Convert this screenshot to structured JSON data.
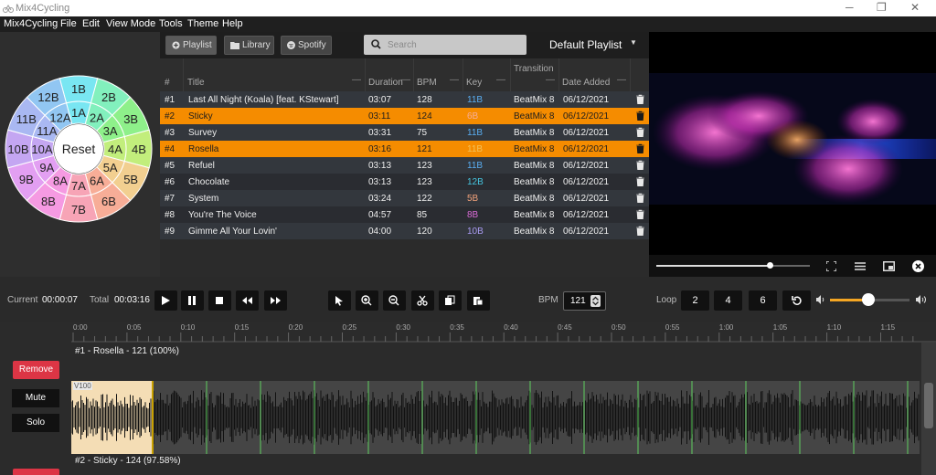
{
  "window": {
    "title": "Mix4Cycling",
    "controls": [
      "─",
      "❐",
      "✕"
    ]
  },
  "menu": [
    "Mix4Cycling",
    "File",
    "Edit",
    "View Mode",
    "Tools",
    "Theme",
    "Help"
  ],
  "wheel": {
    "outer": [
      "1B",
      "2B",
      "3B",
      "4B",
      "5B",
      "6B",
      "7B",
      "8B",
      "9B",
      "10B",
      "11B",
      "12B"
    ],
    "inner": [
      "1A",
      "2A",
      "3A",
      "4A",
      "5A",
      "6A",
      "7A",
      "8A",
      "9A",
      "10A",
      "11A",
      "12A"
    ],
    "colors": [
      "#79e6f2",
      "#82f0bd",
      "#8ef08a",
      "#c2ee7c",
      "#f2cf90",
      "#f7ad97",
      "#f7a4b6",
      "#f59ae2",
      "#e29ff2",
      "#c4a6f2",
      "#a9b8f2",
      "#91c6f2"
    ],
    "center_label": "Reset"
  },
  "toolbar": {
    "playlist": "Playlist",
    "library": "Library",
    "spotify": "Spotify",
    "search_placeholder": "Search",
    "playlist_name": "Default Playlist"
  },
  "table": {
    "headers": {
      "num": "#",
      "title": "Title",
      "duration": "Duration",
      "bpm": "BPM",
      "key": "Key",
      "transition": "Transition",
      "date": "Date Added"
    },
    "rows": [
      {
        "num": "#1",
        "title": "Last All Night (Koala) [feat. KStewart]",
        "duration": "03:07",
        "bpm": "128",
        "key": "11B",
        "key_color": "#5aaef2",
        "transition": "BeatMix 8",
        "date": "06/12/2021",
        "selected": false
      },
      {
        "num": "#2",
        "title": "Sticky",
        "duration": "03:11",
        "bpm": "124",
        "key": "6B",
        "key_color": "#f7ad97",
        "transition": "BeatMix 8",
        "date": "06/12/2021",
        "selected": true
      },
      {
        "num": "#3",
        "title": "Survey",
        "duration": "03:31",
        "bpm": "75",
        "key": "11B",
        "key_color": "#5aaef2",
        "transition": "BeatMix 8",
        "date": "06/12/2021",
        "selected": false
      },
      {
        "num": "#4",
        "title": "Rosella",
        "duration": "03:16",
        "bpm": "121",
        "key": "11B",
        "key_color": "#f2c25a",
        "transition": "BeatMix 8",
        "date": "06/12/2021",
        "selected": true
      },
      {
        "num": "#5",
        "title": "Refuel",
        "duration": "03:13",
        "bpm": "123",
        "key": "11B",
        "key_color": "#5aaef2",
        "transition": "BeatMix 8",
        "date": "06/12/2021",
        "selected": false
      },
      {
        "num": "#6",
        "title": "Chocolate",
        "duration": "03:13",
        "bpm": "123",
        "key": "12B",
        "key_color": "#46c6e0",
        "transition": "BeatMix 8",
        "date": "06/12/2021",
        "selected": false
      },
      {
        "num": "#7",
        "title": "System",
        "duration": "03:24",
        "bpm": "122",
        "key": "5B",
        "key_color": "#f2a27a",
        "transition": "BeatMix 8",
        "date": "06/12/2021",
        "selected": false
      },
      {
        "num": "#8",
        "title": "You're The Voice",
        "duration": "04:57",
        "bpm": "85",
        "key": "8B",
        "key_color": "#d96bd6",
        "transition": "BeatMix 8",
        "date": "06/12/2021",
        "selected": false
      },
      {
        "num": "#9",
        "title": "Gimme All Your Lovin'",
        "duration": "04:00",
        "bpm": "120",
        "key": "10B",
        "key_color": "#a99bf2",
        "transition": "BeatMix 8",
        "date": "06/12/2021",
        "selected": false
      }
    ]
  },
  "video": {
    "progress": 0.74,
    "icons": [
      "fullscreen-icon",
      "list-icon",
      "picture-in-picture-icon",
      "close-icon"
    ]
  },
  "transport": {
    "current_label": "Current",
    "current": "00:00:07",
    "total_label": "Total",
    "total": "00:03:16",
    "bpm_label": "BPM",
    "bpm": "121",
    "loop_label": "Loop",
    "loops": [
      "2",
      "4",
      "6"
    ],
    "volume": 0.48
  },
  "timeline": {
    "ticks": [
      "0:00",
      "0:05",
      "0:10",
      "0:15",
      "0:20",
      "0:25",
      "0:30",
      "0:35",
      "0:40",
      "0:45",
      "0:50",
      "0:55",
      "1:00",
      "1:05",
      "1:10",
      "1:15"
    ],
    "track1": "#1 - Rosella - 121 (100%)",
    "track2": "#2 - Sticky - 124 (97.58%)",
    "marker": "V100",
    "buttons": {
      "remove": "Remove",
      "mute": "Mute",
      "solo": "Solo"
    }
  }
}
